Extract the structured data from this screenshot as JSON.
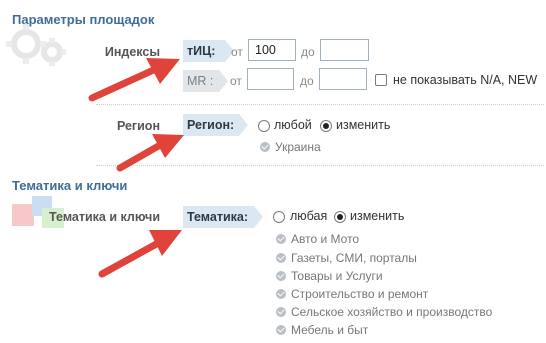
{
  "sections": {
    "platform_params_title": "Параметры площадок",
    "themes_title": "Тематика и ключи"
  },
  "indexes": {
    "row_label": "Индексы",
    "tic_tag": "тИЦ:",
    "tic_from_label": "от",
    "tic_from_value": "100",
    "tic_to_label": "до",
    "tic_to_value": "",
    "mr_tag": "MR :",
    "mr_from_label": "от",
    "mr_from_value": "",
    "mr_to_label": "до",
    "mr_to_value": "",
    "hide_na_label": "не показывать N/A, NEW"
  },
  "region": {
    "row_label": "Регион",
    "tag": "Регион:",
    "option_any": "любой",
    "option_change": "изменить",
    "selected": "изменить",
    "selected_items": [
      "Украина"
    ]
  },
  "themes": {
    "row_label": "Тематика и ключи",
    "tag": "Тематика:",
    "option_any": "любая",
    "option_change": "изменить",
    "selected": "изменить",
    "selected_items": [
      "Авто и Мото",
      "Газеты, СМИ, порталы",
      "Товары и Услуги",
      "Строительство и ремонт",
      "Сельское хозяйство и производство",
      "Мебель и быт"
    ]
  },
  "icons": {
    "gears": "gears-icon",
    "cubes": "cubes-icon",
    "arrow": "red-arrow-icon",
    "check": "check-circle-icon"
  },
  "colors": {
    "section_title": "#3d6e99",
    "tag_bg": "#dbe7f1",
    "arrow": "#e0433a"
  }
}
